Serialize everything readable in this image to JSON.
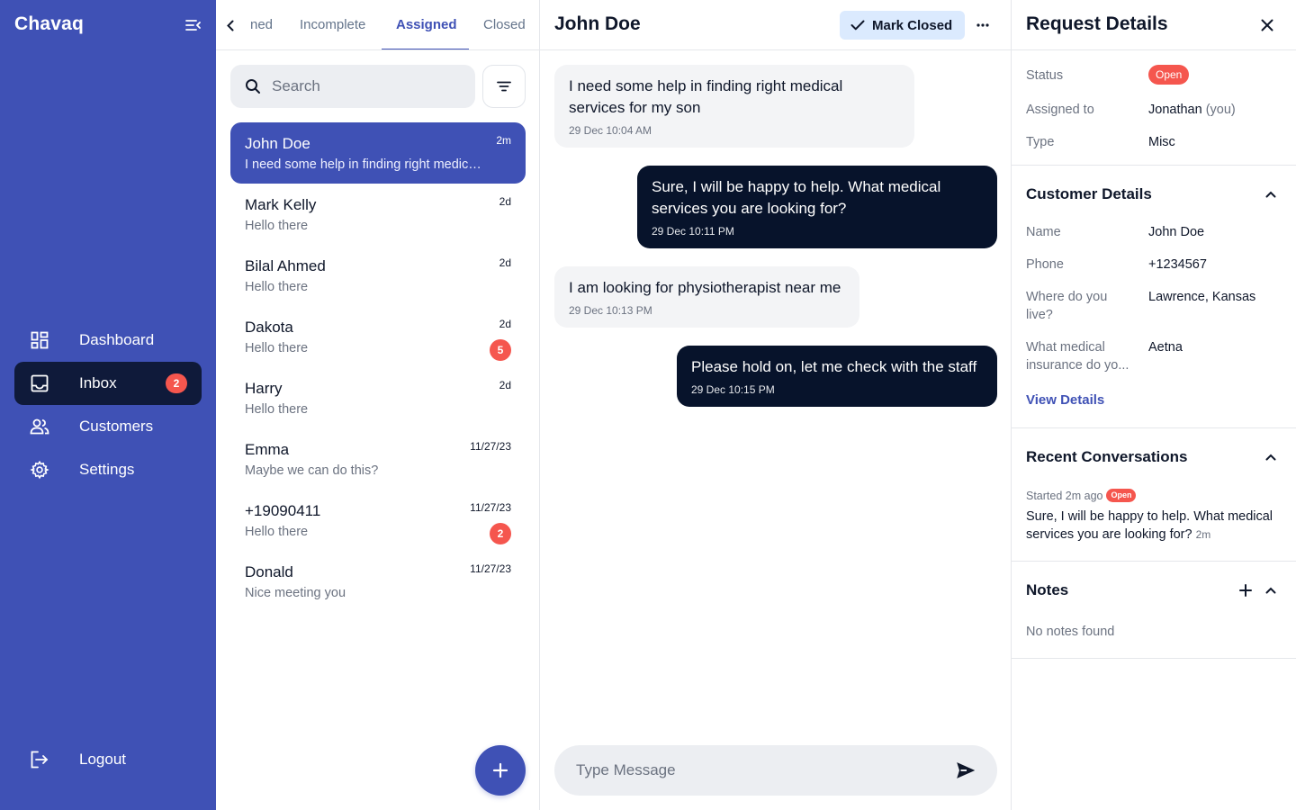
{
  "app": {
    "brand": "Chavaq"
  },
  "sidebar": {
    "items": [
      {
        "label": "Dashboard",
        "icon": "dashboard-icon"
      },
      {
        "label": "Inbox",
        "icon": "inbox-icon",
        "badge": "2",
        "active": true
      },
      {
        "label": "Customers",
        "icon": "users-icon"
      },
      {
        "label": "Settings",
        "icon": "gear-icon"
      }
    ],
    "logout_label": "Logout"
  },
  "tabs": {
    "items": [
      "ned",
      "Incomplete",
      "Assigned",
      "Closed"
    ],
    "active": "Assigned"
  },
  "search": {
    "placeholder": "Search"
  },
  "conversations": [
    {
      "name": "John Doe",
      "preview": "I need some help in finding right medical services for my son",
      "time": "2m",
      "active": true
    },
    {
      "name": "Mark Kelly",
      "preview": "Hello there",
      "time": "2d"
    },
    {
      "name": "Bilal Ahmed",
      "preview": "Hello there",
      "time": "2d"
    },
    {
      "name": "Dakota",
      "preview": "Hello there",
      "time": "2d",
      "badge": "5"
    },
    {
      "name": "Harry",
      "preview": "Hello there",
      "time": "2d"
    },
    {
      "name": "Emma",
      "preview": "Maybe we can do this?",
      "time": "11/27/23"
    },
    {
      "name": "+19090411",
      "preview": "Hello there",
      "time": "11/27/23",
      "badge": "2"
    },
    {
      "name": "Donald",
      "preview": "Nice meeting you",
      "time": "11/27/23"
    }
  ],
  "chat": {
    "title": "John Doe",
    "mark_closed_label": "Mark Closed",
    "messages": [
      {
        "direction": "in",
        "text": "I need some help in finding right medical services for my son",
        "time": "29 Dec 10:04 AM"
      },
      {
        "direction": "out",
        "text": "Sure, I will be happy to help. What medical services you are looking for?",
        "time": "29 Dec 10:11 PM"
      },
      {
        "direction": "in",
        "text": "I am looking for physiotherapist near me",
        "time": "29 Dec 10:13 PM"
      },
      {
        "direction": "out",
        "text": "Please hold on, let me check with the staff",
        "time": "29 Dec 10:15 PM"
      }
    ],
    "composer_placeholder": "Type Message"
  },
  "details": {
    "title": "Request Details",
    "request": {
      "status_label": "Status",
      "status_value": "Open",
      "assigned_label": "Assigned to",
      "assigned_value": "Jonathan",
      "assigned_suffix": "(you)",
      "type_label": "Type",
      "type_value": "Misc"
    },
    "customer": {
      "title": "Customer Details",
      "name_label": "Name",
      "name_value": "John Doe",
      "phone_label": "Phone",
      "phone_value": "+1234567",
      "live_label": "Where do you live?",
      "live_value": "Lawrence, Kansas",
      "insurance_label": "What medical insurance do yo...",
      "insurance_value": "Aetna",
      "view_details": "View Details"
    },
    "recent": {
      "title": "Recent Conversations",
      "started": "Started 2m ago",
      "status": "Open",
      "text": "Sure, I will be happy to help. What medical services you are looking for?",
      "ago": "2m"
    },
    "notes": {
      "title": "Notes",
      "empty": "No notes found"
    }
  },
  "colors": {
    "primary": "#3f51b5",
    "dark": "#07132b",
    "badge": "#f5564e",
    "mark_closed_bg": "#dbeafe"
  }
}
